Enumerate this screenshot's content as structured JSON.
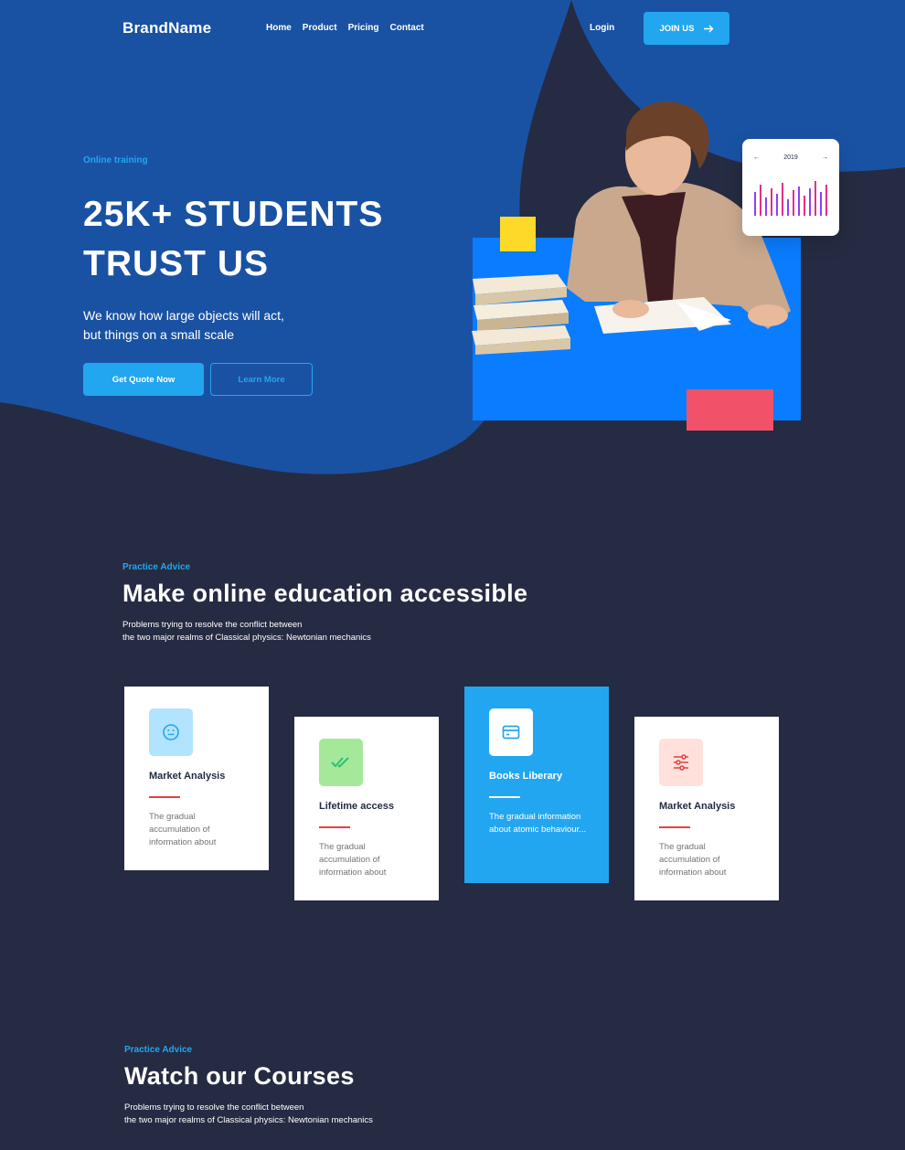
{
  "nav": {
    "brand": "BrandName",
    "links": [
      "Home",
      "Product",
      "Pricing",
      "Contact"
    ],
    "login": "Login",
    "join": "JOIN US",
    "join_icon": "arrow-right-icon"
  },
  "hero": {
    "eyebrow": "Online training",
    "title_line1": "25K+ STUDENTS",
    "title_line2": "TRUST US",
    "subtitle_line1": "We know how large objects will act,",
    "subtitle_line2": "but things on a small scale",
    "primary_button": "Get Quote Now",
    "secondary_button": "Learn More",
    "chart_widget": {
      "year": "2019",
      "prev_icon": "arrow-left-icon",
      "next_icon": "arrow-right-icon"
    }
  },
  "advice": {
    "eyebrow": "Practice Advice",
    "title": "Make online education accessible",
    "desc_line1": "Problems trying to resolve the conflict between",
    "desc_line2": "the two major realms of Classical physics: Newtonian mechanics"
  },
  "cards": [
    {
      "title": "Market Analysis",
      "desc": "The gradual accumulation of information about",
      "icon": "smiley-icon",
      "icon_bg": "#B2E3FF",
      "icon_color": "#23A6F0"
    },
    {
      "title": "Lifetime access",
      "desc": "The gradual accumulation of information about",
      "icon": "double-check-icon",
      "icon_bg": "#A6E89A",
      "icon_color": "#2DC071"
    },
    {
      "title": "Books Liberary",
      "desc": "The gradual information about atomic behaviour...",
      "icon": "card-icon",
      "icon_bg": "#FFFFFF",
      "icon_color": "#23A6F0"
    },
    {
      "title": "Market Analysis",
      "desc": "The gradual accumulation of information about",
      "icon": "sliders-icon",
      "icon_bg": "#FFE0DA",
      "icon_color": "#E74040"
    }
  ],
  "courses": {
    "eyebrow": "Practice Advice",
    "title": "Watch our Courses",
    "desc_line1": "Problems trying to resolve the conflict between",
    "desc_line2": "the two major realms of Classical physics: Newtonian mechanics"
  },
  "colors": {
    "primary": "#23A6F0",
    "hero_blue": "#1A52A3",
    "dark": "#252B42",
    "accent_yellow": "#FFD928",
    "accent_red": "#F25269",
    "card_blue": "#0A7CFF"
  }
}
